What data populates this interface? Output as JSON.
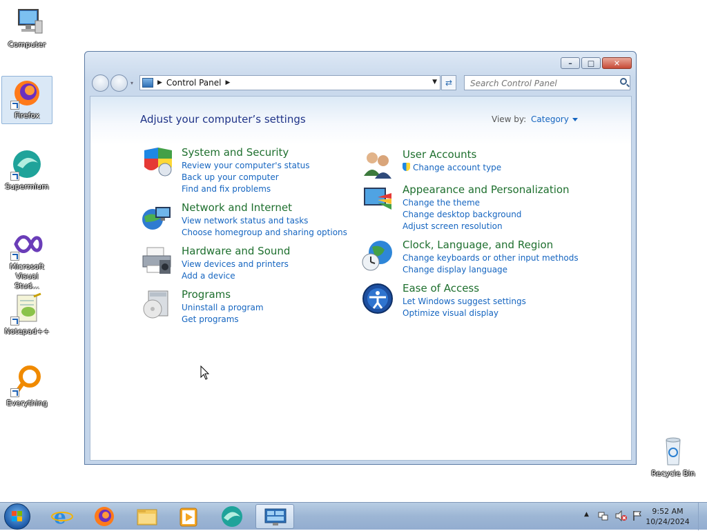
{
  "desktop": {
    "icons": [
      {
        "label": "Computer"
      },
      {
        "label": "Firefox"
      },
      {
        "label": "Supermium"
      },
      {
        "label": "Microsoft Visual Stud..."
      },
      {
        "label": "Notepad++"
      },
      {
        "label": "Everything"
      },
      {
        "label": "Recycle Bin"
      }
    ]
  },
  "window": {
    "address": {
      "crumb": "Control Panel"
    },
    "search": {
      "placeholder": "Search Control Panel"
    },
    "heading": "Adjust your computer’s settings",
    "view_by": {
      "label": "View by:",
      "value": "Category"
    },
    "categories_left": [
      {
        "title": "System and Security",
        "links": [
          "Review your computer's status",
          "Back up your computer",
          "Find and fix problems"
        ]
      },
      {
        "title": "Network and Internet",
        "links": [
          "View network status and tasks",
          "Choose homegroup and sharing options"
        ]
      },
      {
        "title": "Hardware and Sound",
        "links": [
          "View devices and printers",
          "Add a device"
        ]
      },
      {
        "title": "Programs",
        "links": [
          "Uninstall a program",
          "Get programs"
        ]
      }
    ],
    "categories_right": [
      {
        "title": "User Accounts",
        "links": [
          "Change account type"
        ]
      },
      {
        "title": "Appearance and Personalization",
        "links": [
          "Change the theme",
          "Change desktop background",
          "Adjust screen resolution"
        ]
      },
      {
        "title": "Clock, Language, and Region",
        "links": [
          "Change keyboards or other input methods",
          "Change display language"
        ]
      },
      {
        "title": "Ease of Access",
        "links": [
          "Let Windows suggest settings",
          "Optimize visual display"
        ]
      }
    ]
  },
  "taskbar": {
    "clock": {
      "time": "9:52 AM",
      "date": "10/24/2024"
    },
    "pinned": [
      "internet-explorer",
      "firefox",
      "file-explorer",
      "media-player",
      "supermium",
      "control-panel"
    ]
  },
  "colors": {
    "link": "#1565c0",
    "category_title": "#1e6f2e",
    "heading": "#1e3287"
  }
}
